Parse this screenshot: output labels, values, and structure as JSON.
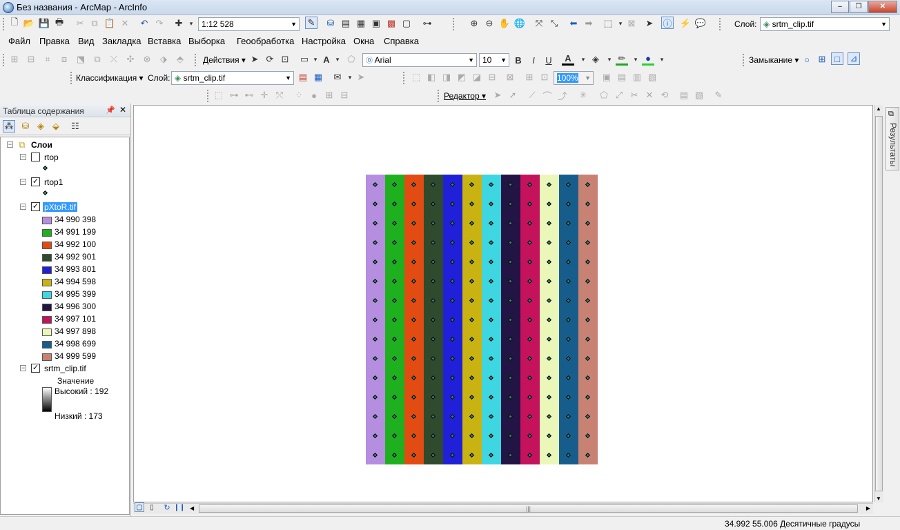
{
  "window": {
    "title": "Без названия - ArcMap - ArcInfo",
    "buttons": [
      "–",
      "❐",
      "✕"
    ]
  },
  "toolbar_standard": {
    "scale": "1:12 528",
    "layer_label": "Слой:",
    "layer_value": "srtm_clip.tif"
  },
  "menu": [
    "Файл",
    "Правка",
    "Вид",
    "Закладка",
    "Вставка",
    "Выборка",
    "Геообработка",
    "Настройка",
    "Окна",
    "Справка"
  ],
  "drawing": {
    "actions_label": "Действия",
    "font": "Arial",
    "font_size": "10",
    "bold": "B",
    "italic": "I",
    "underline": "U",
    "snapping_label": "Замыкание"
  },
  "classification": {
    "label": "Классификация",
    "layer_label": "Слой:",
    "layer_value": "srtm_clip.tif",
    "transparency": "100%"
  },
  "editor": {
    "label": "Редактор"
  },
  "toc": {
    "title": "Таблица содержания",
    "root": "Слои",
    "layers": [
      {
        "name": "rtop",
        "checked": false
      },
      {
        "name": "rtop1",
        "checked": true
      },
      {
        "name": "pXtoR.tif",
        "checked": true,
        "selected": true
      },
      {
        "name": "srtm_clip.tif",
        "checked": true
      }
    ],
    "classes": [
      {
        "label": "34 990 398",
        "color": "#b58ee0"
      },
      {
        "label": "34 991 199",
        "color": "#1fb01f"
      },
      {
        "label": "34 992 100",
        "color": "#e24b12"
      },
      {
        "label": "34 992 901",
        "color": "#2f4a2c"
      },
      {
        "label": "34 993 801",
        "color": "#2020d8"
      },
      {
        "label": "34 994 598",
        "color": "#c9b312"
      },
      {
        "label": "34 995 399",
        "color": "#3ed6e0"
      },
      {
        "label": "34 996 300",
        "color": "#221444"
      },
      {
        "label": "34 997 101",
        "color": "#c4125c"
      },
      {
        "label": "34 997 898",
        "color": "#eaf7b8"
      },
      {
        "label": "34 998 699",
        "color": "#175d8c"
      },
      {
        "label": "34 999 599",
        "color": "#c78274"
      }
    ],
    "srtm": {
      "value_label": "Значение",
      "high": "Высокий : 192",
      "low": "Низкий : 173"
    }
  },
  "side_tab": "Результаты",
  "status": {
    "coords": "34.992  55.006 Десятичные градусы"
  }
}
